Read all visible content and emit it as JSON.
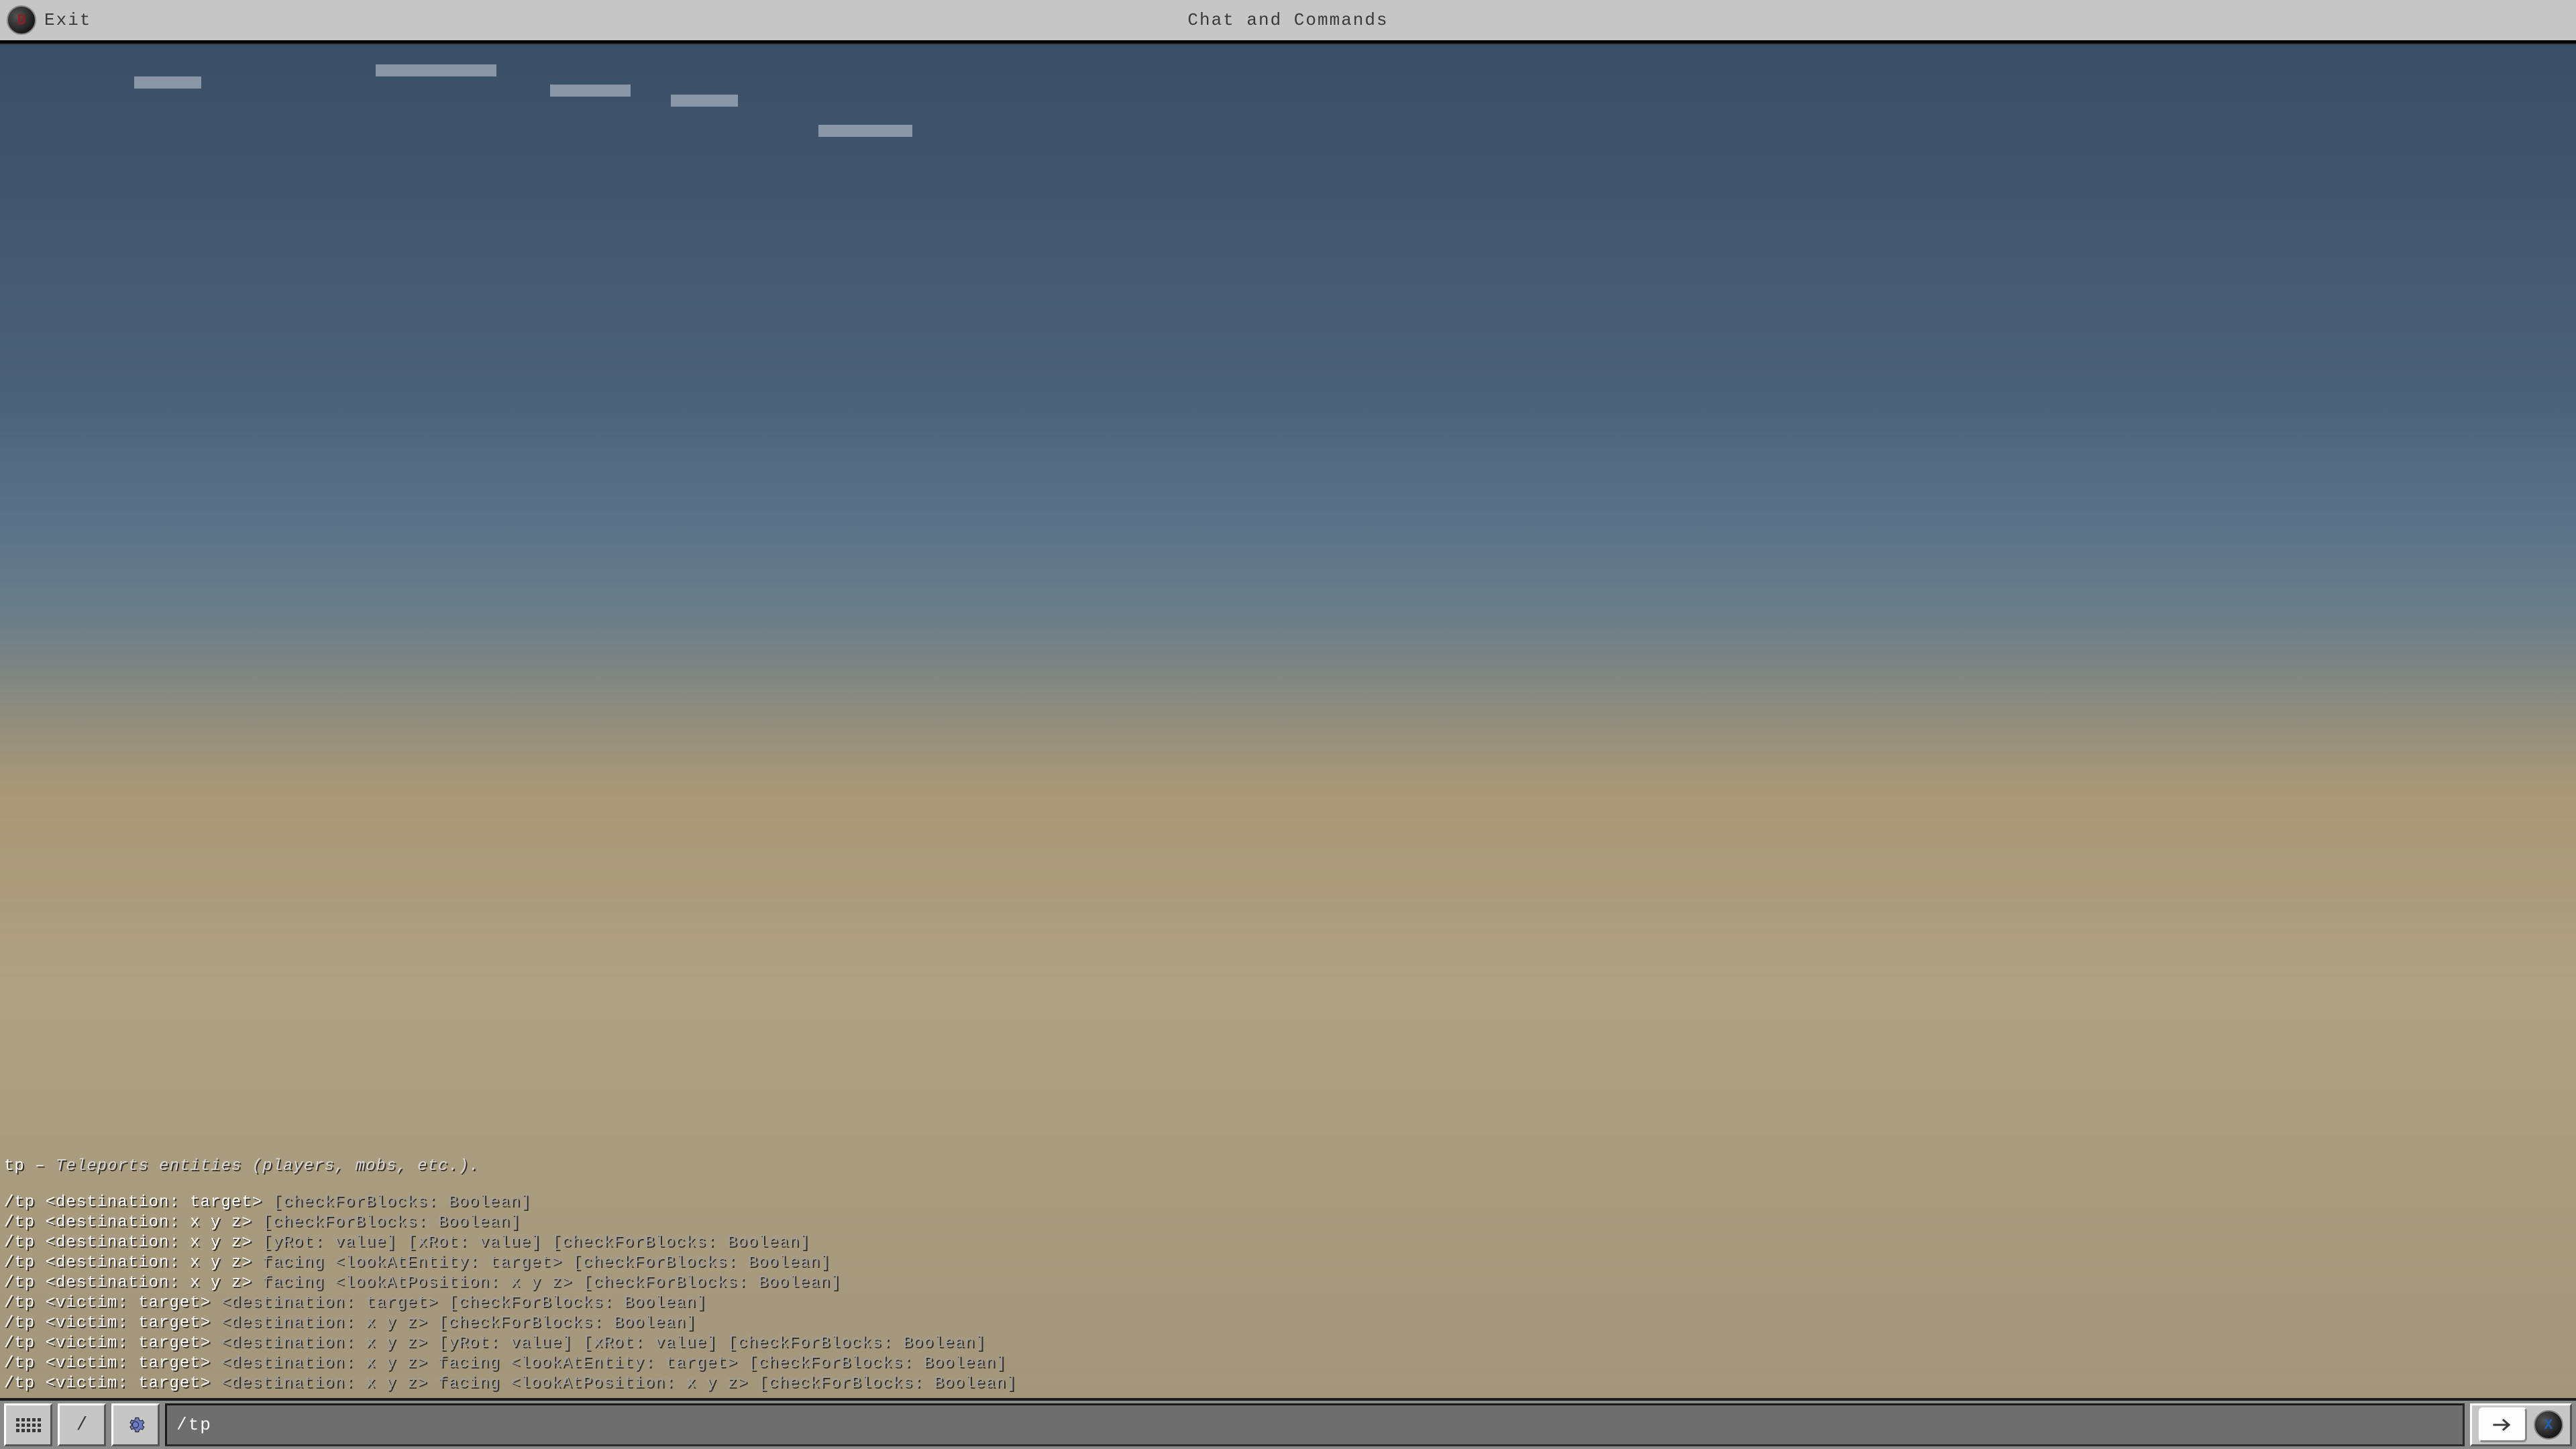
{
  "header": {
    "exit_label": "Exit",
    "exit_badge": "B",
    "title": "Chat and Commands"
  },
  "command_help": {
    "name": "tp",
    "sep": " – ",
    "description": "Teleports entities (players, mobs, etc.).",
    "syntax": [
      [
        [
          "w",
          "/tp <destination: target> "
        ],
        [
          "g",
          "[checkForBlocks: Boolean]"
        ]
      ],
      [
        [
          "w",
          "/tp <destination: x y z> "
        ],
        [
          "g",
          "[checkForBlocks: Boolean]"
        ]
      ],
      [
        [
          "w",
          "/tp <destination: x y z> "
        ],
        [
          "g",
          "[yRot: value] [xRot: value] [checkForBlocks: Boolean]"
        ]
      ],
      [
        [
          "w",
          "/tp <destination: x y z> "
        ],
        [
          "g",
          "facing <lookAtEntity: target> [checkForBlocks: Boolean]"
        ]
      ],
      [
        [
          "w",
          "/tp <destination: x y z> "
        ],
        [
          "g",
          "facing <lookAtPosition: x y z> [checkForBlocks: Boolean]"
        ]
      ],
      [
        [
          "w",
          "/tp <victim: target> "
        ],
        [
          "g",
          "<destination: target> [checkForBlocks: Boolean]"
        ]
      ],
      [
        [
          "w",
          "/tp <victim: target> "
        ],
        [
          "g",
          "<destination: x y z> [checkForBlocks: Boolean]"
        ]
      ],
      [
        [
          "w",
          "/tp <victim: target> "
        ],
        [
          "g",
          "<destination: x y z> [yRot: value] [xRot: value] [checkForBlocks: Boolean]"
        ]
      ],
      [
        [
          "w",
          "/tp <victim: target> "
        ],
        [
          "g",
          "<destination: x y z> facing <lookAtEntity: target> [checkForBlocks: Boolean]"
        ]
      ],
      [
        [
          "w",
          "/tp <victim: target> "
        ],
        [
          "g",
          "<destination: x y z> facing <lookAtPosition: x y z> [checkForBlocks: Boolean]"
        ]
      ]
    ]
  },
  "bottom_bar": {
    "keyboard_label": "keyboard",
    "slash_label": "/",
    "settings_label": "settings",
    "input_value": "/tp",
    "send_label": "→",
    "send_badge": "X"
  },
  "icons": {
    "keyboard": "keyboard-icon",
    "slash": "slash-icon",
    "gear": "gear-icon",
    "send": "send-icon",
    "b_badge": "b-badge-icon",
    "x_badge": "x-badge-icon"
  }
}
